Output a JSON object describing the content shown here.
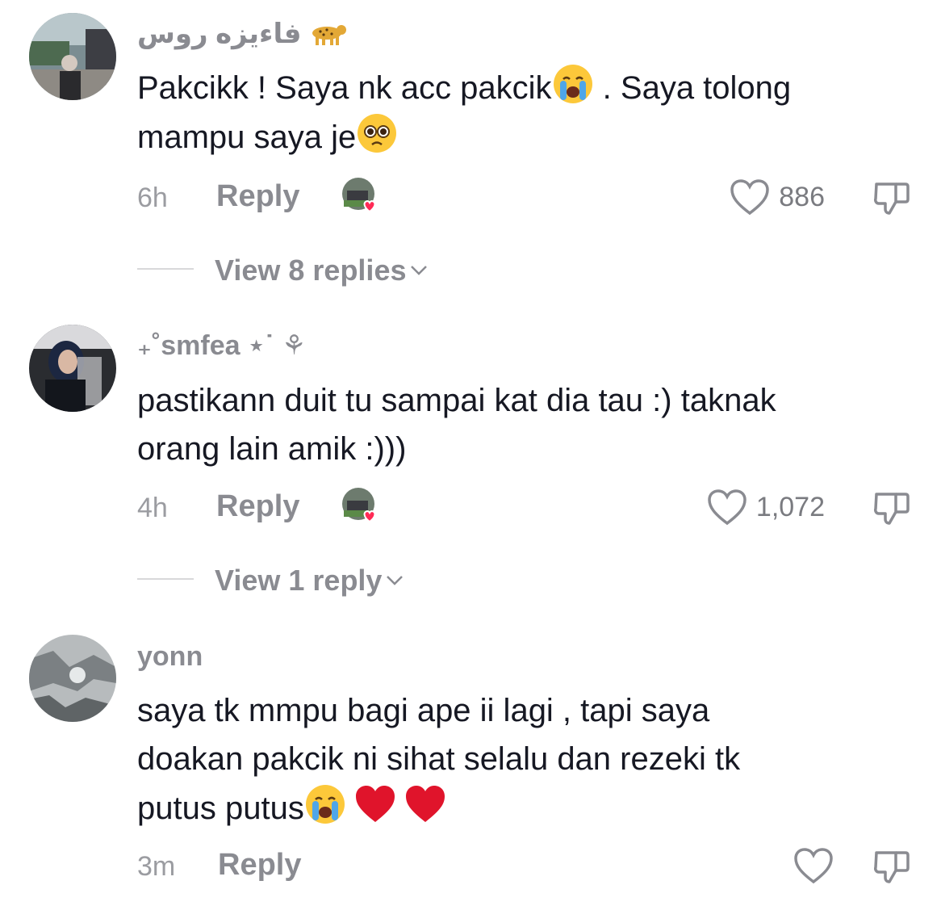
{
  "comments": [
    {
      "username": "فاءيزه روس",
      "text_line1": "Pakcikk ! Saya nk acc pakcik",
      "text_line1b": " . Saya tolong",
      "text_line2": "mampu saya je",
      "time": "6h",
      "reply_label": "Reply",
      "like_count": "886",
      "view_replies": "View 8 replies"
    },
    {
      "username": "₊˚smfea ⋆˙ ⚘",
      "text_line1": "pastikann duit tu sampai kat dia tau :) taknak",
      "text_line2": "orang lain amik :)))",
      "time": "4h",
      "reply_label": "Reply",
      "like_count": "1,072",
      "view_replies": "View 1 reply"
    },
    {
      "username": "yonn",
      "text_line1": "saya tk mmpu bagi ape ii lagi , tapi saya",
      "text_line2": "doakan pakcik ni sihat selalu dan rezeki tk",
      "text_line3": "putus putus",
      "time": "3m",
      "reply_label": "Reply",
      "like_count": ""
    }
  ],
  "icons": {
    "like": "heart-outline-icon",
    "dislike": "thumbs-down-icon",
    "expand": "chevron-down-icon",
    "crying": "crying-face-emoji",
    "pleading": "pleading-face-emoji",
    "heart": "red-heart-emoji"
  },
  "colors": {
    "text": "#161823",
    "muted": "#8a8b91",
    "heart_red": "#e0142b"
  }
}
